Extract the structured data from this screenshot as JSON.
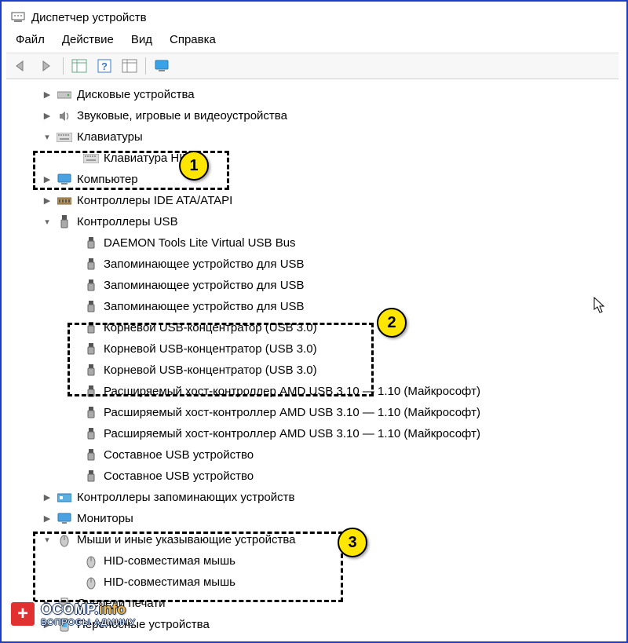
{
  "title": "Диспетчер устройств",
  "menu": {
    "file": "Файл",
    "action": "Действие",
    "view": "Вид",
    "help": "Справка"
  },
  "tree": {
    "disk": "Дисковые устройства",
    "audio": "Звуковые, игровые и видеоустройства",
    "keyboards": "Клавиатуры",
    "keyboard_hid": "Клавиатура HID",
    "computer": "Компьютер",
    "ide": "Контроллеры IDE ATA/ATAPI",
    "usb_controllers": "Контроллеры USB",
    "usb": {
      "daemon": "DAEMON Tools Lite Virtual USB Bus",
      "mass1": "Запоминающее устройство для USB",
      "mass2": "Запоминающее устройство для USB",
      "mass3": "Запоминающее устройство для USB",
      "root1": "Корневой USB-концентратор (USB 3.0)",
      "root2": "Корневой USB-концентратор (USB 3.0)",
      "root3": "Корневой USB-концентратор (USB 3.0)",
      "host1": "Расширяемый хост-контроллер AMD USB 3.10 — 1.10 (Майкрософт)",
      "host2": "Расширяемый хост-контроллер AMD USB 3.10 — 1.10 (Майкрософт)",
      "host3": "Расширяемый хост-контроллер AMD USB 3.10 — 1.10 (Майкрософт)",
      "comp1": "Составное USB устройство",
      "comp2": "Составное USB устройство"
    },
    "storage_controllers": "Контроллеры запоминающих устройств",
    "monitors": "Мониторы",
    "mice": "Мыши и иные указывающие устройства",
    "mouse1": "HID-совместимая мышь",
    "mouse2": "HID-совместимая мышь",
    "print_queues": "Очереди печати",
    "portable": "Переносные устройства"
  },
  "callouts": {
    "c1": "1",
    "c2": "2",
    "c3": "3"
  },
  "watermark": {
    "brand_prefix": "O",
    "brand_comp": "COMP",
    "brand_dot": ".",
    "brand_info": "info",
    "tagline": "ВОПРОСЫ АДМИНУ"
  }
}
